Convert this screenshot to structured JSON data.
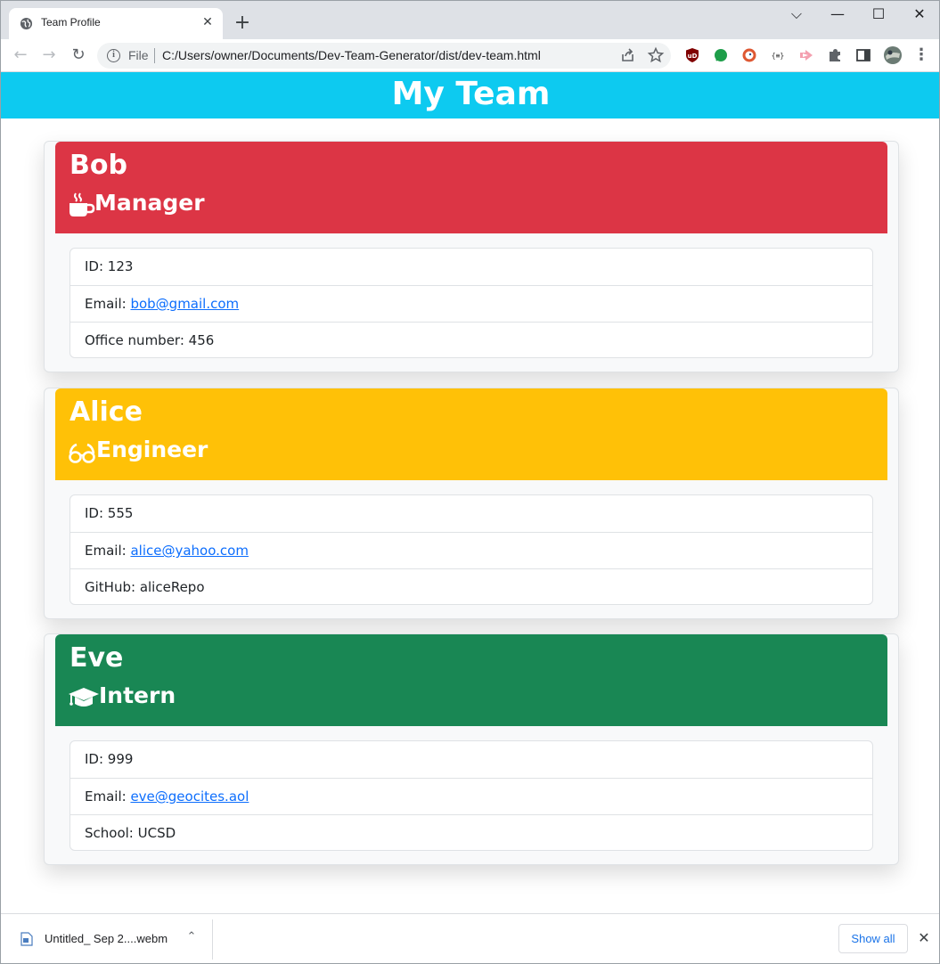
{
  "browser": {
    "tab_title": "Team Profile",
    "tab_close": "✕",
    "new_tab": "+",
    "window_controls": {
      "tab_search": "⌵",
      "minimize": "—",
      "maximize": "☐",
      "close": "✕"
    },
    "nav": {
      "back": "←",
      "forward": "→",
      "reload": "↻"
    },
    "address": {
      "scheme_label": "File",
      "url": "C:/Users/owner/Documents/Dev-Team-Generator/dist/dev-team.html"
    },
    "omnibox_icons": [
      "share-icon",
      "star-icon"
    ],
    "extensions": [
      "ublock-icon",
      "green-leaf-icon",
      "duckduckgo-icon",
      "json-viewer-icon",
      "pink-arrow-icon",
      "puzzle-icon",
      "side-panel-icon",
      "profile-avatar",
      "kebab-menu-icon"
    ]
  },
  "page": {
    "title": "My Team",
    "header_color": "#0dcaf0",
    "cards": [
      {
        "name": "Bob",
        "role": "Manager",
        "icon": "mug-hot-icon",
        "color": "#dc3545",
        "items": [
          {
            "label": "ID: ",
            "value": "123"
          },
          {
            "label": "Email: ",
            "value": "bob@gmail.com",
            "link": true
          },
          {
            "label": "Office number: ",
            "value": "456"
          }
        ]
      },
      {
        "name": "Alice",
        "role": "Engineer",
        "icon": "glasses-icon",
        "color": "#ffc107",
        "items": [
          {
            "label": "ID: ",
            "value": "555"
          },
          {
            "label": "Email: ",
            "value": "alice@yahoo.com",
            "link": true
          },
          {
            "label": "GitHub: ",
            "value": "aliceRepo"
          }
        ]
      },
      {
        "name": "Eve",
        "role": "Intern",
        "icon": "graduation-cap-icon",
        "color": "#198754",
        "items": [
          {
            "label": "ID: ",
            "value": "999"
          },
          {
            "label": "Email: ",
            "value": "eve@geocites.aol",
            "link": true
          },
          {
            "label": "School: ",
            "value": "UCSD"
          }
        ]
      }
    ]
  },
  "downloads": {
    "file_name": "Untitled_ Sep 2....webm",
    "show_all": "Show all",
    "close": "✕",
    "chevron": "⌃"
  }
}
